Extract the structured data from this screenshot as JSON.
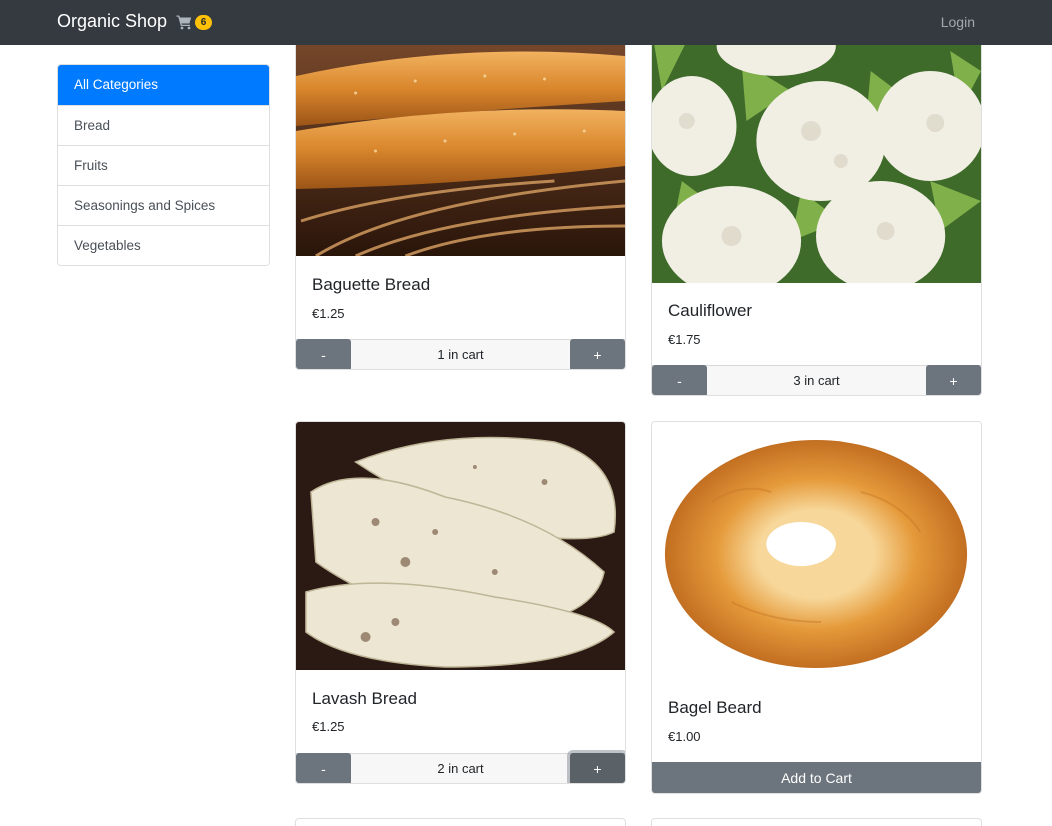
{
  "navbar": {
    "brand": "Organic Shop",
    "cart_count": "6",
    "login_label": "Login"
  },
  "categories": [
    {
      "label": "All Categories",
      "active": true
    },
    {
      "label": "Bread"
    },
    {
      "label": "Fruits"
    },
    {
      "label": "Seasonings and Spices"
    },
    {
      "label": "Vegetables"
    }
  ],
  "products": [
    {
      "title": "Baguette Bread",
      "price": "€1.25",
      "cart_text": "1 in cart",
      "minus": "-",
      "plus": "+"
    },
    {
      "title": "Cauliflower",
      "price": "€1.75",
      "cart_text": "3 in cart",
      "minus": "-",
      "plus": "+"
    },
    {
      "title": "Lavash Bread",
      "price": "€1.25",
      "cart_text": "2 in cart",
      "minus": "-",
      "plus": "+"
    },
    {
      "title": "Bagel Beard",
      "price": "€1.00",
      "add_label": "Add to Cart"
    }
  ]
}
